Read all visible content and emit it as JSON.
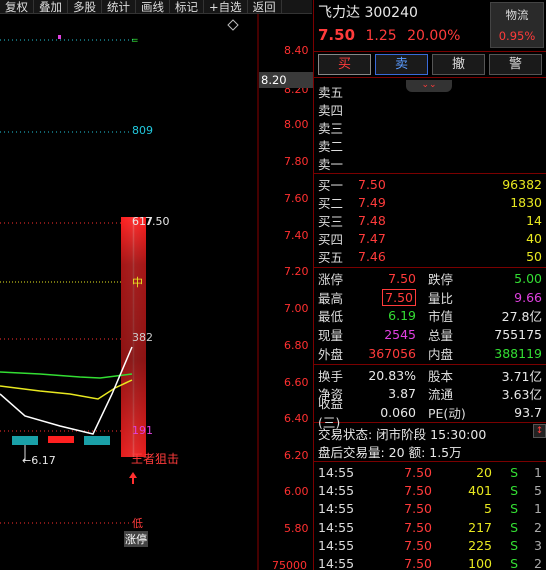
{
  "toolbar": {
    "items": [
      "复权",
      "叠加",
      "多股",
      "统计",
      "画线",
      "标记",
      "+自选",
      "返回"
    ]
  },
  "chart": {
    "price_ticks": [
      "8.40",
      "8.20",
      "8.00",
      "7.80",
      "7.60",
      "7.40",
      "7.20",
      "7.00",
      "6.80",
      "6.60",
      "6.40",
      "6.20",
      "6.00",
      "5.80"
    ],
    "bottom_tick": "75000",
    "current_price_tag": "8.20",
    "levels": {
      "l809": "809",
      "l617": "617",
      "l750": "7.50",
      "mid": "中",
      "l382": "382",
      "l191": "191",
      "low": "低"
    },
    "low_marker": "←6.17",
    "annotation": "王者狙击",
    "limit_up_tag": "涨停",
    "colors": {
      "bar": "#ff1a1a",
      "ma_white": "#ffffff",
      "ma_yellow": "#e8e820",
      "ma_green": "#33dd33",
      "cyan": "#22c8dd"
    }
  },
  "quote": {
    "name": "飞力达",
    "code": "300240",
    "price": "7.50",
    "change": "1.25",
    "change_pct": "20.00%",
    "sector": "物流",
    "sector_pct": "0.95%"
  },
  "actions": {
    "buy": "买",
    "sell": "卖",
    "cancel": "撤",
    "alert": "警"
  },
  "asks": [
    {
      "label": "卖五",
      "price": "",
      "vol": ""
    },
    {
      "label": "卖四",
      "price": "",
      "vol": ""
    },
    {
      "label": "卖三",
      "price": "",
      "vol": ""
    },
    {
      "label": "卖二",
      "price": "",
      "vol": ""
    },
    {
      "label": "卖一",
      "price": "",
      "vol": ""
    }
  ],
  "bids": [
    {
      "label": "买一",
      "price": "7.50",
      "vol": "96382"
    },
    {
      "label": "买二",
      "price": "7.49",
      "vol": "1830"
    },
    {
      "label": "买三",
      "price": "7.48",
      "vol": "14"
    },
    {
      "label": "买四",
      "price": "7.47",
      "vol": "40"
    },
    {
      "label": "买五",
      "price": "7.46",
      "vol": "50"
    }
  ],
  "stats": {
    "zhangting_l": "涨停",
    "zhangting": "7.50",
    "dieting_l": "跌停",
    "dieting": "5.00",
    "zuigao_l": "最高",
    "zuigao": "7.50",
    "liangbi_l": "量比",
    "liangbi": "9.66",
    "zuidi_l": "最低",
    "zuidi": "6.19",
    "shizhi_l": "市值",
    "shizhi": "27.8亿",
    "xianliang_l": "现量",
    "xianliang": "2545",
    "zongliang_l": "总量",
    "zongliang": "755175",
    "waipan_l": "外盘",
    "waipan": "367056",
    "neipan_l": "内盘",
    "neipan": "388119"
  },
  "fund": {
    "huanshou_l": "换手",
    "huanshou": "20.83%",
    "guben_l": "股本",
    "guben": "3.71亿",
    "jingzi_l": "净资",
    "jingzi": "3.87",
    "liutong_l": "流通",
    "liutong": "3.63亿",
    "shouyi_l": "收益(三)",
    "shouyi": "0.060",
    "pe_l": "PE(动)",
    "pe": "93.7"
  },
  "status": {
    "state": "交易状态: 闭市阶段 15:30:00",
    "after": "盘后交易量: 20  额: 1.5万"
  },
  "ticks": [
    {
      "time": "14:55",
      "price": "7.50",
      "vol": "20",
      "flag": "S",
      "n": "1"
    },
    {
      "time": "14:55",
      "price": "7.50",
      "vol": "401",
      "flag": "S",
      "n": "5"
    },
    {
      "time": "14:55",
      "price": "7.50",
      "vol": "5",
      "flag": "S",
      "n": "1"
    },
    {
      "time": "14:55",
      "price": "7.50",
      "vol": "217",
      "flag": "S",
      "n": "2"
    },
    {
      "time": "14:55",
      "price": "7.50",
      "vol": "225",
      "flag": "S",
      "n": "3"
    },
    {
      "time": "14:55",
      "price": "7.50",
      "vol": "100",
      "flag": "S",
      "n": "2"
    }
  ]
}
